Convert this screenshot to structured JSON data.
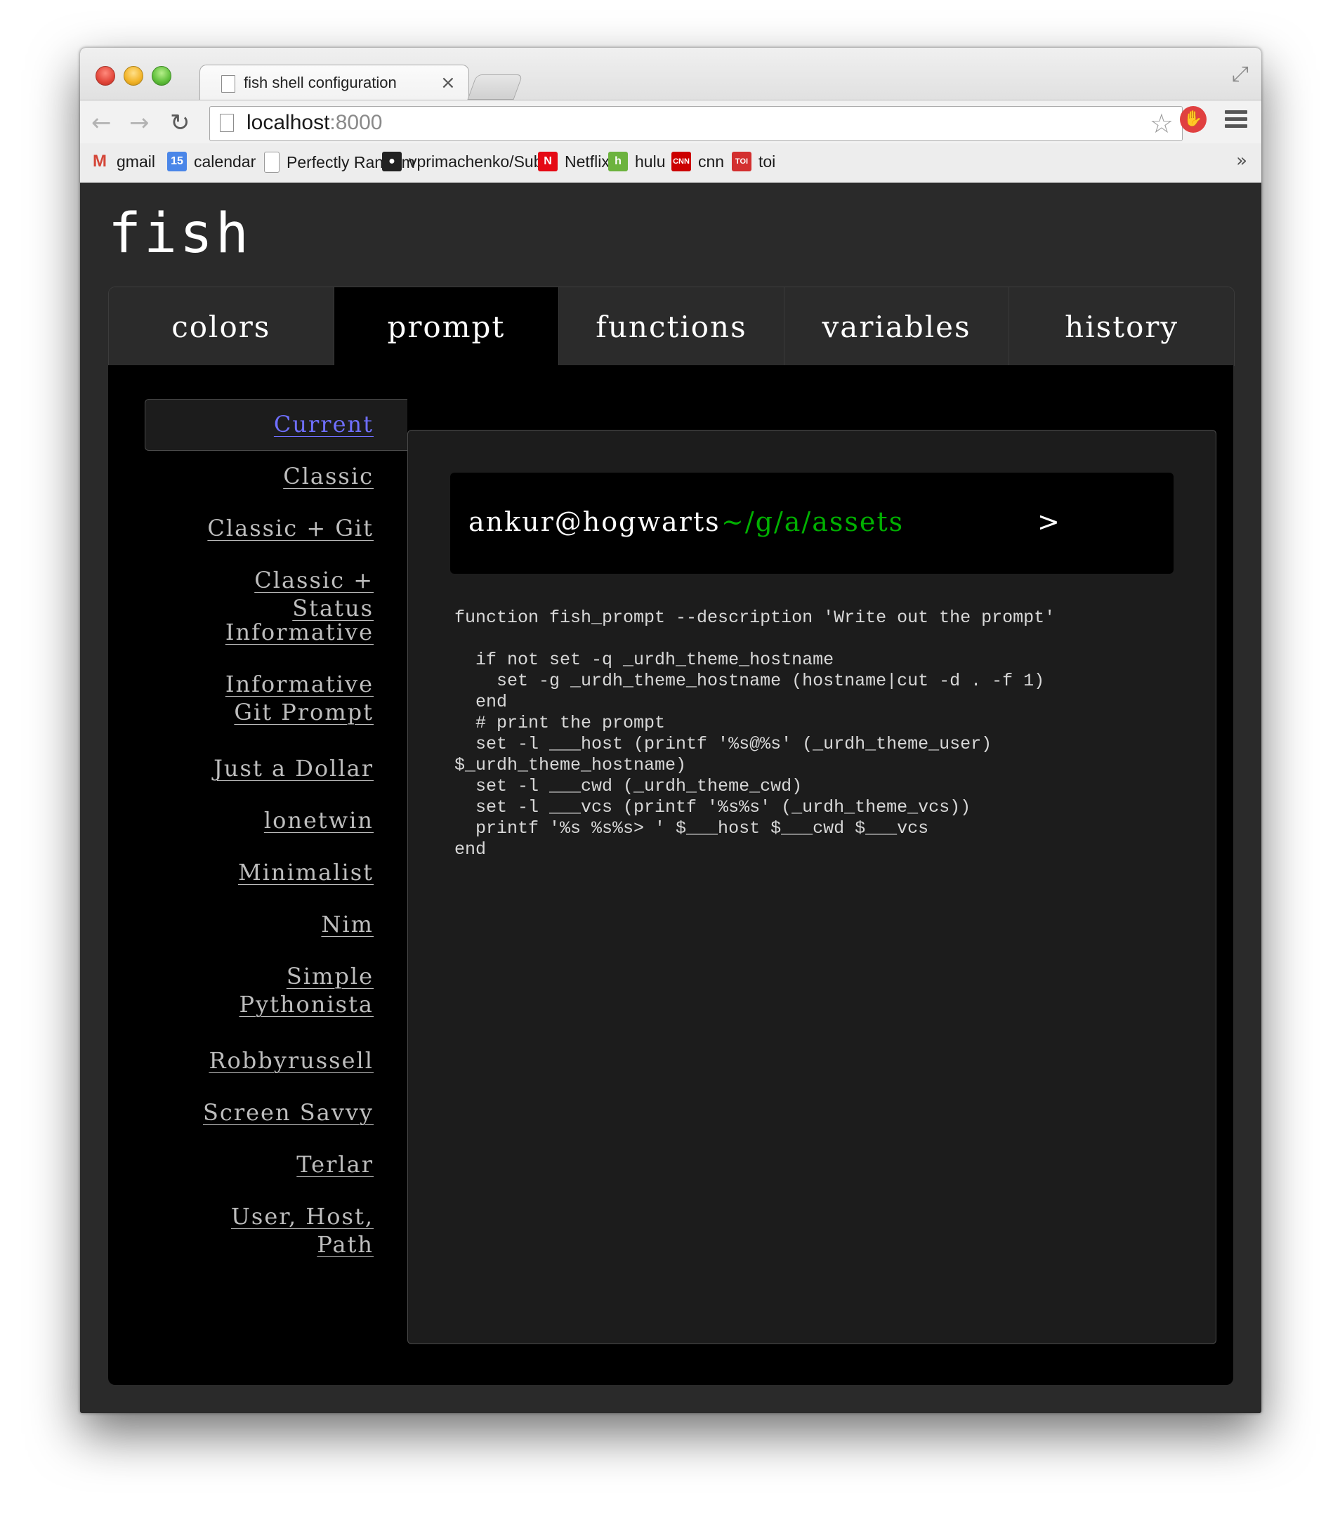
{
  "browser": {
    "tab_title": "fish shell configuration",
    "tab_close": "×",
    "url_host": "localhost",
    "url_port": ":8000",
    "bookmarks": [
      {
        "label": "gmail",
        "icon": "gmail-icon",
        "glyph": "M",
        "color": "#d44638"
      },
      {
        "label": "calendar",
        "icon": "calendar-icon",
        "glyph": "15",
        "color": "#4a86e8"
      },
      {
        "label": "Perfectly Random",
        "icon": "page-icon",
        "glyph": "",
        "color": "#ffffff"
      },
      {
        "label": "vprimachenko/Subli",
        "icon": "github-icon",
        "glyph": "●",
        "color": "#222222"
      },
      {
        "label": "Netflix",
        "icon": "netflix-icon",
        "glyph": "N",
        "color": "#e50914"
      },
      {
        "label": "hulu",
        "icon": "hulu-icon",
        "glyph": "h",
        "color": "#6cb33e"
      },
      {
        "label": "cnn",
        "icon": "cnn-icon",
        "glyph": "CNN",
        "color": "#cc0000"
      },
      {
        "label": "toi",
        "icon": "toi-icon",
        "glyph": "TOI",
        "color": "#d32f2f"
      }
    ],
    "more": "»"
  },
  "app": {
    "logo": "fish",
    "tabs": [
      "colors",
      "prompt",
      "functions",
      "variables",
      "history"
    ],
    "selected_tab": "prompt"
  },
  "prompts": {
    "items": [
      "Current",
      "Classic",
      "Classic + Git",
      "Classic + Status",
      "Informative",
      "Informative Git Prompt",
      "Just a Dollar",
      "lonetwin",
      "Minimalist",
      "Nim",
      "Simple Pythonista",
      "Robbyrussell",
      "Screen Savvy",
      "Terlar",
      "User, Host, Path"
    ],
    "selected": "Current"
  },
  "preview": {
    "user_host": "ankur@hogwarts",
    "cwd": "~/g/a/assets",
    "symbol": ">",
    "cwd_color": "#00b000"
  },
  "code": "function fish_prompt --description 'Write out the prompt'\n\n  if not set -q _urdh_theme_hostname\n    set -g _urdh_theme_hostname (hostname|cut -d . -f 1)\n  end\n  # print the prompt\n  set -l ___host (printf '%s@%s' (_urdh_theme_user)\n$_urdh_theme_hostname)\n  set -l ___cwd (_urdh_theme_cwd)\n  set -l ___vcs (printf '%s%s' (_urdh_theme_vcs))\n  printf '%s %s%s> ' $___host $___cwd $___vcs\nend"
}
